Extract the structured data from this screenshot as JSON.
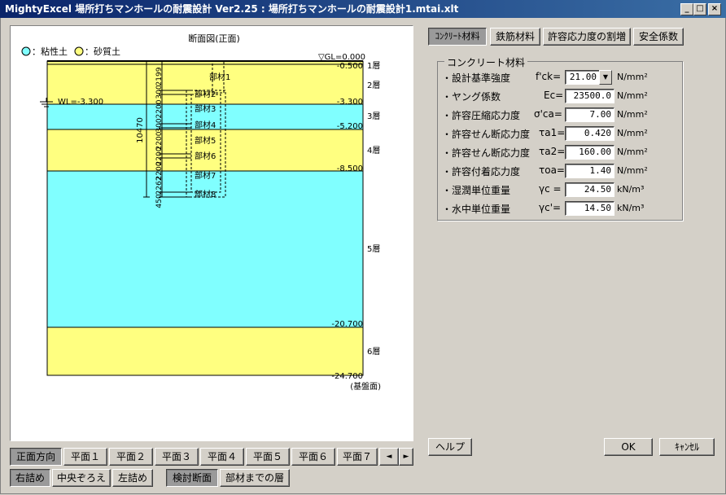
{
  "window": {
    "title": "MightyExcel 場所打ちマンホールの耐震設計 Ver2.25 : 場所打ちマンホールの耐震設計1.mtai.xlt",
    "min": "_",
    "max": "□",
    "close": "×"
  },
  "diagram": {
    "title": "断面図(正面)",
    "legend_clay": "：粘性土",
    "legend_sand": "：砂質土",
    "gl_label": "▽GL=0.000",
    "wl_label": "WL=-3.300",
    "bedrock_label": "(基盤面)",
    "depths": [
      "-0.500",
      "-3.300",
      "-5.200",
      "-8.500",
      "-20.700",
      "-24.700"
    ],
    "layers": [
      "1層",
      "2層",
      "3層",
      "4層",
      "5層",
      "6層"
    ],
    "members": [
      "部材1",
      "部材2",
      "部材3",
      "部材4",
      "部材5",
      "部材6",
      "部材7",
      "部材8"
    ],
    "total_dim": "10470",
    "dims": [
      "2199",
      "300",
      "2200",
      "300",
      "2200",
      "2200",
      "2200",
      "2150",
      "2262"
    ],
    "bottom_dim": "450",
    "soil_colors": {
      "clay": "#80ffff",
      "sand": "#ffff80"
    }
  },
  "view_tabs": [
    "正面方向",
    "平面１",
    "平面２",
    "平面３",
    "平面４",
    "平面５",
    "平面６",
    "平面７"
  ],
  "align_buttons": [
    "右詰め",
    "中央ぞろえ",
    "左詰め"
  ],
  "section_buttons": [
    "検討断面",
    "部材までの層"
  ],
  "right_tabs": [
    "ｺﾝｸﾘｰﾄ材料",
    "鉄筋材料",
    "許容応力度の割増",
    "安全係数"
  ],
  "group_title": "コンクリート材料",
  "fields": [
    {
      "label": "・設計基準強度",
      "sym": "f'ck=",
      "value": "21.00",
      "unit": "N/mm²",
      "dropdown": true
    },
    {
      "label": "・ヤング係数",
      "sym": "Ec=",
      "value": "23500.0",
      "unit": "N/mm²"
    },
    {
      "label": "・許容圧縮応力度",
      "sym": "σ'ca=",
      "value": "7.00",
      "unit": "N/mm²"
    },
    {
      "label": "・許容せん断応力度",
      "sym": "τa1=",
      "value": "0.420",
      "unit": "N/mm²"
    },
    {
      "label": "・許容せん断応力度",
      "sym": "τa2=",
      "value": "160.00",
      "unit": "N/mm²"
    },
    {
      "label": "・許容付着応力度",
      "sym": "τoa=",
      "value": "1.40",
      "unit": "N/mm²"
    },
    {
      "label": "・湿潤単位重量",
      "sym": "γc =",
      "value": "24.50",
      "unit": "kN/m³"
    },
    {
      "label": "・水中単位重量",
      "sym": "γc'=",
      "value": "14.50",
      "unit": "kN/m³"
    }
  ],
  "footer": {
    "help": "ヘルプ",
    "ok": "OK",
    "cancel": "ｷｬﾝｾﾙ"
  }
}
